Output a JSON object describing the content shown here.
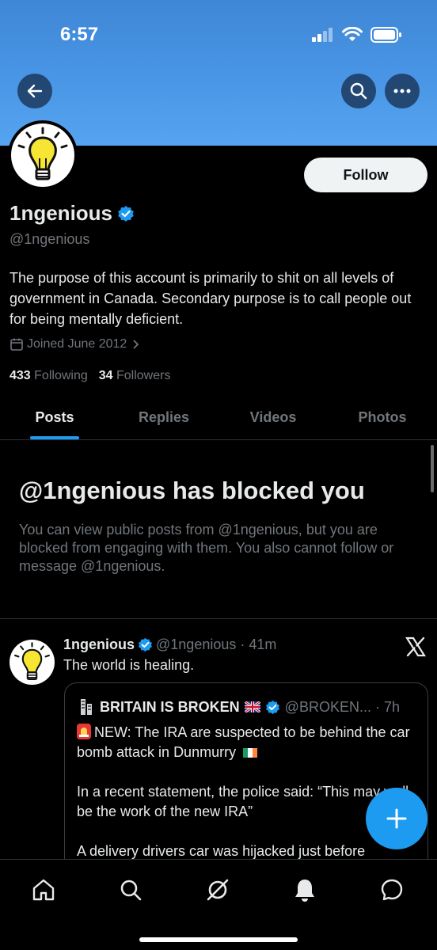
{
  "status_bar": {
    "time": "6:57"
  },
  "header": {
    "back_icon": "arrow-left-icon",
    "search_icon": "search-icon",
    "more_icon": "more-icon"
  },
  "profile": {
    "follow_label": "Follow",
    "display_name": "1ngenious",
    "handle": "@1ngenious",
    "bio": "The purpose of this account is primarily to shit on all levels of government in Canada. Secondary purpose is to call people out for being mentally deficient.",
    "joined": "Joined June 2012",
    "following_count": "433",
    "following_label": "Following",
    "followers_count": "34",
    "followers_label": "Followers"
  },
  "tabs": [
    {
      "label": "Posts",
      "active": true
    },
    {
      "label": "Replies"
    },
    {
      "label": "Videos"
    },
    {
      "label": "Photos"
    }
  ],
  "blocked": {
    "title": "@1ngenious has blocked you",
    "text": "You can view public posts from @1ngenious, but you are blocked from engaging with them. You also cannot follow or message @1ngenious."
  },
  "post": {
    "name": "1ngenious",
    "meta": "@1ngenious · 41m",
    "text": "The world is healing.",
    "quote": {
      "name": "BRITAIN IS BROKEN",
      "meta": "@BROKEN... · 7h",
      "para1": "NEW: The IRA are suspected to be behind the car bomb attack in Dunmurry",
      "para2": "In a recent statement, the police said: “This may well be the work of the new IRA”",
      "para3": "A delivery drivers car was hijacked just before"
    }
  },
  "colors": {
    "accent": "#1d9bf0",
    "banner": "#4a96e6",
    "muted": "#71767b",
    "text": "#e7e9ea"
  }
}
